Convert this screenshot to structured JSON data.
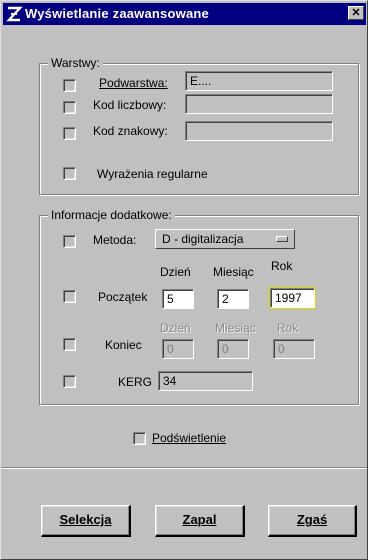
{
  "window": {
    "title": "Wyświetlanie zaawansowane",
    "close_label": "✕"
  },
  "layers_group": {
    "legend": "Warstwy:",
    "sublayer_label": "Podwarstwa:",
    "sublayer_value": "E....",
    "numeric_code_label": "Kod liczbowy:",
    "numeric_code_value": "",
    "char_code_label": "Kod znakowy:",
    "char_code_value": "",
    "regex_label": "Wyrażenia regularne"
  },
  "info_group": {
    "legend": "Informacje dodatkowe:",
    "method_label": "Metoda:",
    "method_value": "D - digitalizacja",
    "start_label": "Początek",
    "end_label": "Koniec",
    "kerg_label": "KERG",
    "kerg_value": "34",
    "col_day": "Dzień",
    "col_month": "Miesiąc",
    "col_year": "Rok",
    "start_day": "5",
    "start_month": "2",
    "start_year": "1997",
    "end_day": "0",
    "end_month": "0",
    "end_year": "0"
  },
  "highlight_label": "Podświetlenie",
  "buttons": {
    "select": "Selekcja",
    "ignite": "Zapal",
    "extinguish": "Zgaś"
  },
  "colors": {
    "titlebar": "#000080",
    "face": "#c0c0c0",
    "field_highlight": "#d8d800"
  },
  "icons": [
    "app-icon",
    "close-icon",
    "checkbox",
    "dropdown-arrow-icon"
  ]
}
